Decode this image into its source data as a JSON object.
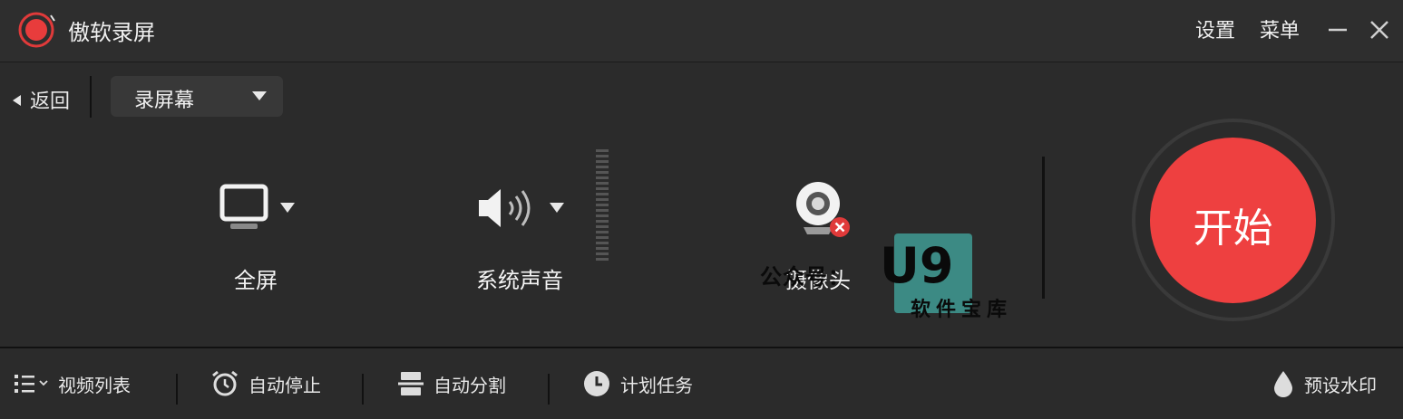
{
  "titlebar": {
    "app_title": "傲软录屏",
    "settings_label": "设置",
    "menu_label": "菜单"
  },
  "toolbar": {
    "back_label": "返回",
    "mode_value": "录屏幕"
  },
  "sources": {
    "screen_label": "全屏",
    "audio_label": "系统声音",
    "camera_label": "摄像头"
  },
  "start_button": {
    "label": "开始",
    "color": "#ee4040"
  },
  "watermark_overlay": {
    "prefix": "公众号：",
    "brand": "U9",
    "subtitle": "软件宝库"
  },
  "bottombar": {
    "video_list_label": "视频列表",
    "auto_stop_label": "自动停止",
    "auto_split_label": "自动分割",
    "schedule_label": "计划任务",
    "watermark_label": "预设水印"
  },
  "icons": [
    "logo-icon",
    "minimize-icon",
    "close-icon",
    "monitor-icon",
    "speaker-icon",
    "webcam-icon",
    "camera-disabled-icon",
    "list-icon",
    "alarm-icon",
    "split-icon",
    "clock-icon",
    "drop-icon"
  ]
}
